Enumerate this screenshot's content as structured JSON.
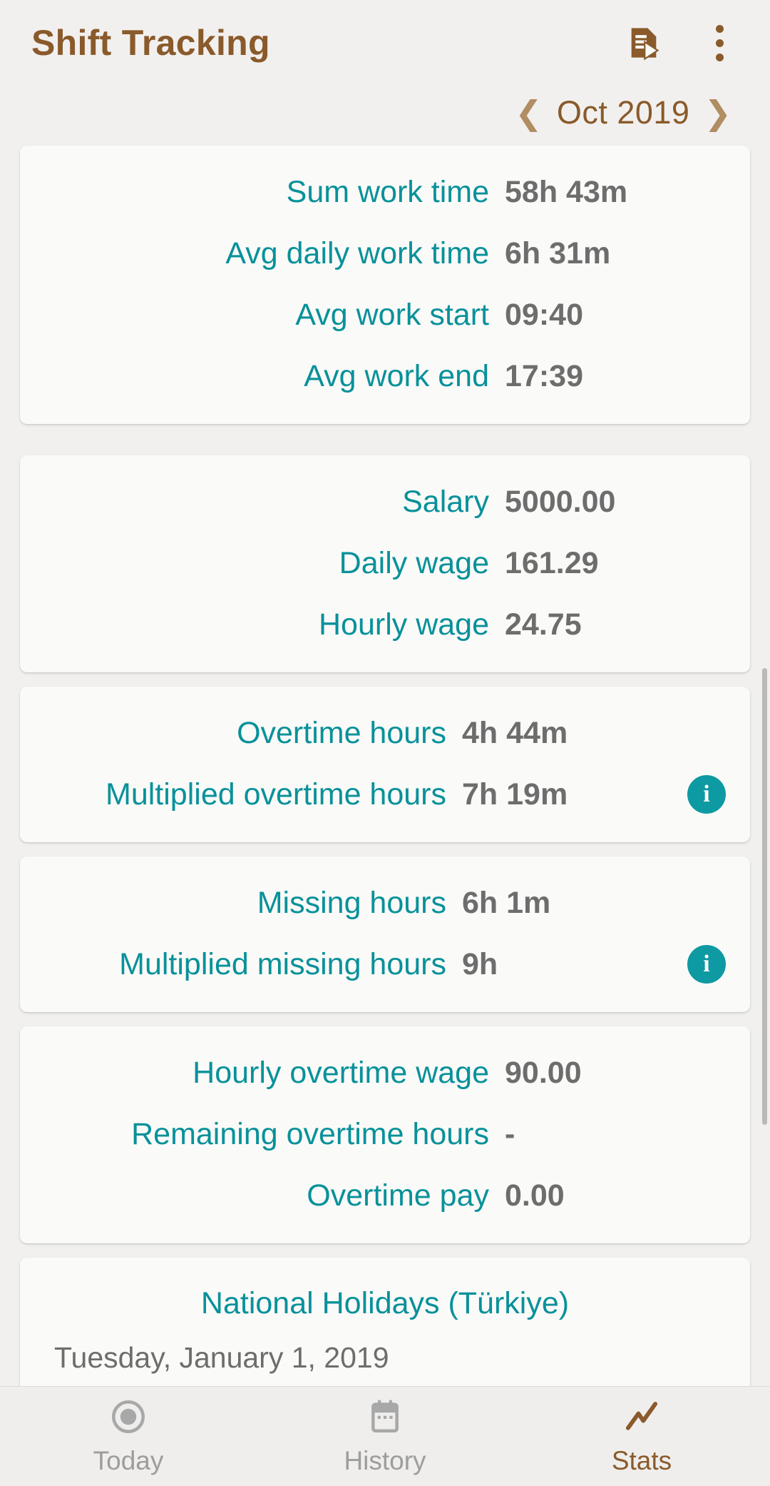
{
  "appbar": {
    "title": "Shift Tracking",
    "export_icon": "export-document-icon",
    "overflow_icon": "more-vertical-icon"
  },
  "month_nav": {
    "prev_icon": "chevron-left-icon",
    "next_icon": "chevron-right-icon",
    "label": "Oct 2019"
  },
  "cards": {
    "work_time": [
      {
        "label": "Sum work time",
        "value": "58h 43m"
      },
      {
        "label": "Avg daily work time",
        "value": "6h 31m"
      },
      {
        "label": "Avg work start",
        "value": "09:40"
      },
      {
        "label": "Avg work end",
        "value": "17:39"
      }
    ],
    "wages": [
      {
        "label": "Salary",
        "value": "5000.00"
      },
      {
        "label": "Daily wage",
        "value": "161.29"
      },
      {
        "label": "Hourly wage",
        "value": "24.75"
      }
    ],
    "overtime": [
      {
        "label": "Overtime hours",
        "value": "4h 44m"
      },
      {
        "label": "Multiplied overtime hours",
        "value": "7h 19m",
        "info": "i"
      }
    ],
    "missing": [
      {
        "label": "Missing hours",
        "value": "6h 1m"
      },
      {
        "label": "Multiplied missing hours",
        "value": "9h",
        "info": "i"
      }
    ],
    "overtime_pay": [
      {
        "label": "Hourly overtime wage",
        "value": "90.00"
      },
      {
        "label": "Remaining overtime hours",
        "value": "-"
      },
      {
        "label": "Overtime pay",
        "value": "0.00"
      }
    ],
    "holidays": {
      "title": "National Holidays (Türkiye)",
      "items": [
        "Tuesday, January 1, 2019"
      ]
    }
  },
  "bottomnav": [
    {
      "label": "Today",
      "icon": "record-circle-icon",
      "active": false
    },
    {
      "label": "History",
      "icon": "calendar-icon",
      "active": false
    },
    {
      "label": "Stats",
      "icon": "trending-up-icon",
      "active": true
    }
  ],
  "colors": {
    "accent_teal": "#08919a",
    "brand_brown": "#8a5a2b",
    "value_gray": "#6d6d6d",
    "page_bg": "#f1f0ee",
    "card_bg": "#fafaf8"
  }
}
